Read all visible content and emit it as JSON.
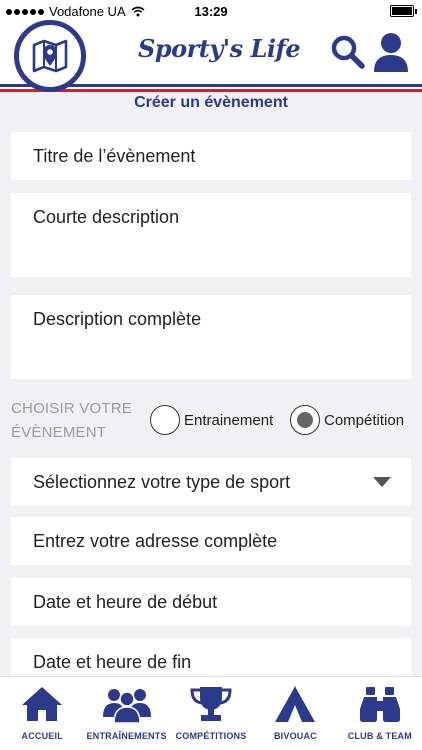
{
  "status_bar": {
    "carrier": "Vodafone UA",
    "time": "13:29"
  },
  "header": {
    "logo_text": "Sporty's Life"
  },
  "page": {
    "title": "Créer un évènement"
  },
  "form": {
    "title_placeholder": "Titre de l’évènement",
    "short_desc_placeholder": "Courte description",
    "full_desc_placeholder": "Description complète",
    "event_choice_label_line1": "CHOISIR VOTRE",
    "event_choice_label_line2": "ÉVÈNEMENT",
    "option_training": "Entrainement",
    "option_competition": "Compétition",
    "selected_option": "Compétition",
    "sport_select": "Sélectionnez votre type de sport",
    "address_placeholder": "Entrez votre adresse complète",
    "start_placeholder": "Date et heure de début",
    "end_placeholder": "Date et heure de fin"
  },
  "bottom_nav": {
    "items": [
      {
        "label": "ACCUEIL",
        "icon": "home-icon"
      },
      {
        "label": "ENTRAÎNEMENTS",
        "icon": "group-icon"
      },
      {
        "label": "COMPÉTITIONS",
        "icon": "trophy-icon"
      },
      {
        "label": "BIVOUAC",
        "icon": "tent-icon"
      },
      {
        "label": "CLUB & TEAM",
        "icon": "binoculars-icon"
      }
    ]
  },
  "colors": {
    "brand_blue": "#2c3a8c",
    "brand_red": "#d4202c",
    "background": "#f1f1f3"
  }
}
